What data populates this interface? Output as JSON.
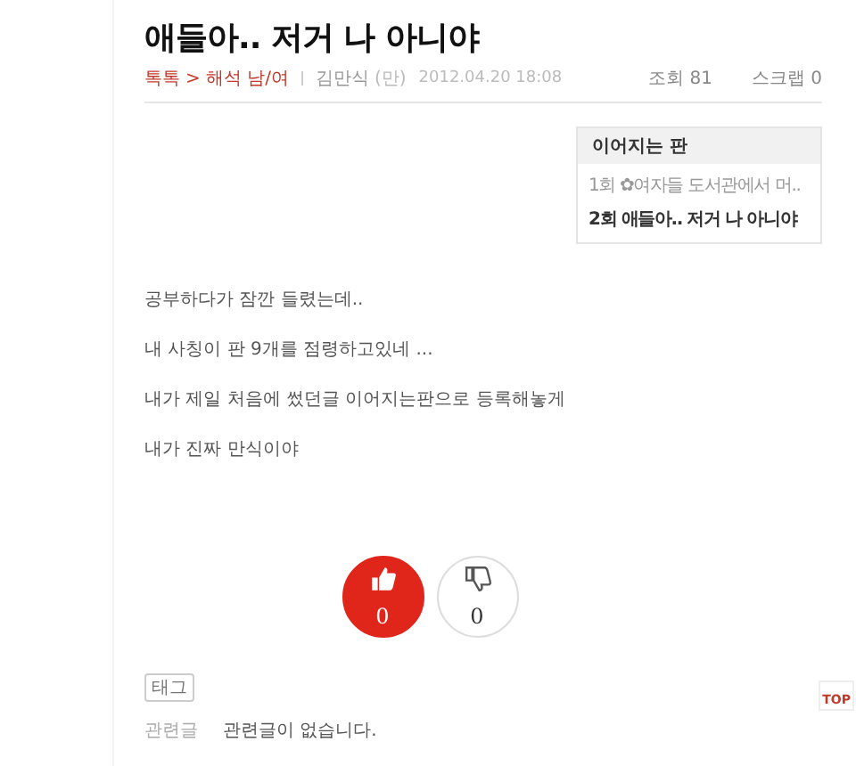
{
  "title": "애들아.. 저거 나 아니야",
  "meta": {
    "breadcrumb_separator": ">",
    "breadcrumb": [
      {
        "label": "톡톡"
      },
      {
        "label": "해석 남/여"
      }
    ],
    "author": "김만식",
    "author_tag": "(만)",
    "date": "2012.04.20 18:08",
    "views": "조회 81",
    "scraps": "스크랩 0"
  },
  "series": {
    "heading": "이어지는 판",
    "items": [
      {
        "label": "1회 ✿여자들 도서관에서 머..",
        "selected": false
      },
      {
        "label": "2회 애들아.. 저거 나 아니야",
        "selected": true
      }
    ]
  },
  "paragraphs": [
    "공부하다가 잠깐 들렸는데..",
    "내 사칭이 판 9개를 점령하고있네 ...",
    "내가 제일 처음에 썼던글 이어지는판으로 등록해놓게",
    "내가 진짜 만식이야"
  ],
  "votes": [
    {
      "kind": "up",
      "count": "0"
    },
    {
      "kind": "down",
      "count": "0"
    }
  ],
  "tag_label": "태그",
  "related": {
    "label": "관련글",
    "text": "관련글이 없습니다."
  },
  "top_button": "TOP"
}
